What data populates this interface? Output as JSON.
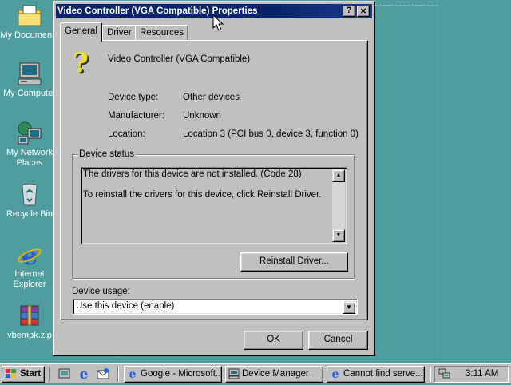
{
  "desktop": {
    "icons": [
      {
        "label": "My Documents",
        "icon": "folder-icon"
      },
      {
        "label": "My Computer",
        "icon": "computer-icon"
      },
      {
        "label": "My Network Places",
        "icon": "network-icon"
      },
      {
        "label": "Recycle Bin",
        "icon": "recycle-bin-icon"
      },
      {
        "label": "Internet Explorer",
        "icon": "ie-icon"
      },
      {
        "label": "vbempk.zip",
        "icon": "winrar-archive-icon"
      }
    ]
  },
  "dialog": {
    "title": "Video Controller (VGA Compatible) Properties",
    "help_glyph": "?",
    "close_glyph": "×",
    "tabs": [
      {
        "label": "General",
        "active": true
      },
      {
        "label": "Driver",
        "active": false
      },
      {
        "label": "Resources",
        "active": false
      }
    ],
    "device_name": "Video Controller (VGA Compatible)",
    "device_icon": "question-mark-device-icon",
    "fields": [
      {
        "label": "Device type:",
        "value": "Other devices"
      },
      {
        "label": "Manufacturer:",
        "value": "Unknown"
      },
      {
        "label": "Location:",
        "value": "Location 3 (PCI bus 0, device 3, function 0)"
      }
    ],
    "status_group_label": "Device status",
    "status_line1": "The drivers for this device are not installed. (Code 28)",
    "status_line2": "To reinstall the drivers for this device, click Reinstall Driver.",
    "reinstall_button": "Reinstall Driver...",
    "usage_label": "Device usage:",
    "usage_value": "Use this device (enable)",
    "ok_button": "OK",
    "cancel_button": "Cancel"
  },
  "taskbar": {
    "start_label": "Start",
    "quick_launch": [
      "show-desktop-icon",
      "ie-icon",
      "outlook-express-icon"
    ],
    "tasks": [
      {
        "label": "Google - Microsoft...",
        "icon": "ie-icon"
      },
      {
        "label": "Device Manager",
        "icon": "computer-icon"
      },
      {
        "label": "Cannot find serve...",
        "icon": "ie-icon"
      }
    ],
    "tray_icon": "network-tray-icon",
    "clock": "3:11 AM"
  },
  "colors": {
    "desktop": "#4f9e9d",
    "titlebar": "#0a246a",
    "face": "#c0c0c0"
  }
}
